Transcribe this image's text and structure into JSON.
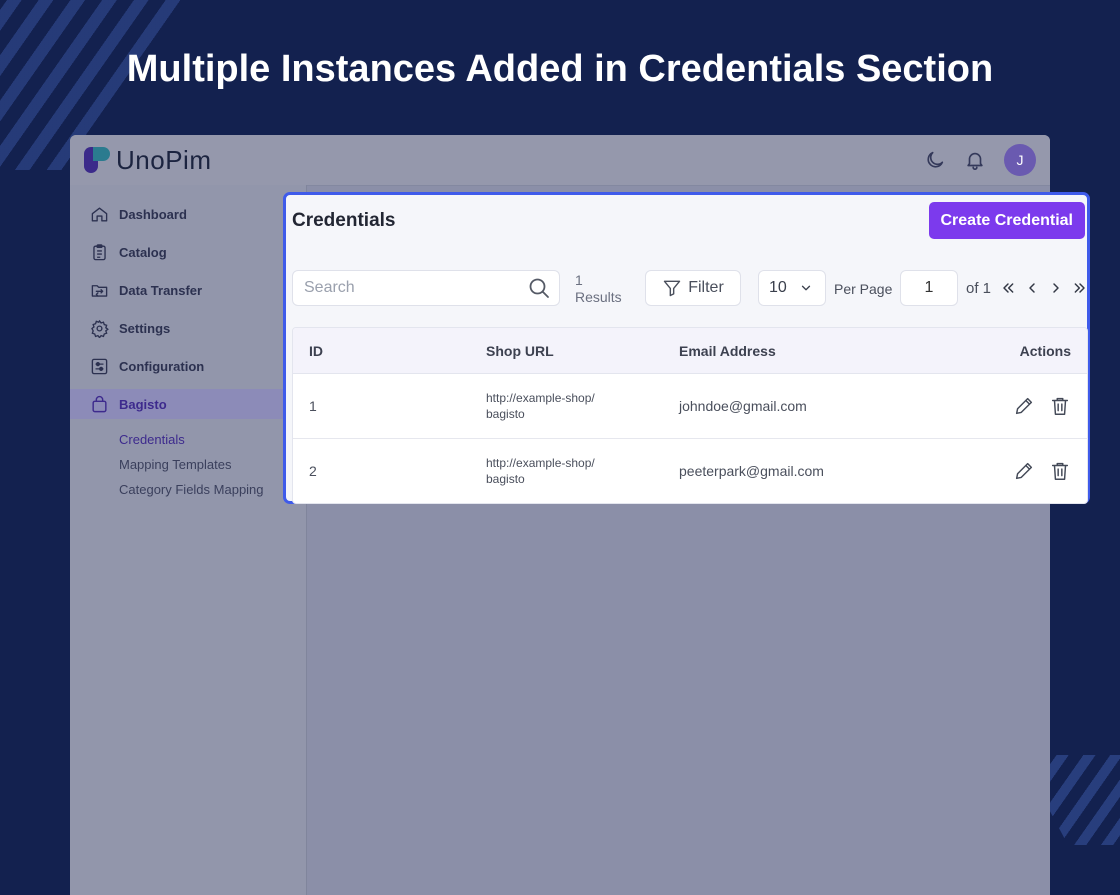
{
  "headline": "Multiple Instances Added in Credentials Section",
  "app": {
    "logo_text": "UnoPim",
    "avatar_initial": "J",
    "sidebar": {
      "items": [
        {
          "label": "Dashboard",
          "icon": "home-icon"
        },
        {
          "label": "Catalog",
          "icon": "clipboard-icon"
        },
        {
          "label": "Data Transfer",
          "icon": "folder-transfer-icon"
        },
        {
          "label": "Settings",
          "icon": "gear-icon"
        },
        {
          "label": "Configuration",
          "icon": "sliders-icon"
        },
        {
          "label": "Bagisto",
          "icon": "shopping-bag-icon"
        }
      ],
      "subitems": [
        {
          "label": "Credentials"
        },
        {
          "label": "Mapping Templates"
        },
        {
          "label": "Category Fields Mapping"
        }
      ]
    }
  },
  "panel": {
    "title": "Credentials",
    "create_button": "Create Credential",
    "search_placeholder": "Search",
    "results_count": "1",
    "results_label": "Results",
    "filter_label": "Filter",
    "per_page_value": "10",
    "per_page_label": "Per Page",
    "page_value": "1",
    "page_of": "of 1",
    "columns": {
      "id": "ID",
      "shop_url": "Shop URL",
      "email": "Email Address",
      "actions": "Actions"
    },
    "rows": [
      {
        "id": "1",
        "url_line1": "http://example-shop/",
        "url_line2": "bagisto",
        "email": "johndoe@gmail.com"
      },
      {
        "id": "2",
        "url_line1": "http://example-shop/",
        "url_line2": "bagisto",
        "email": "peeterpark@gmail.com"
      }
    ]
  },
  "colors": {
    "background": "#13214f",
    "accent": "#7c3aed",
    "highlight_border": "#3f5bea"
  }
}
